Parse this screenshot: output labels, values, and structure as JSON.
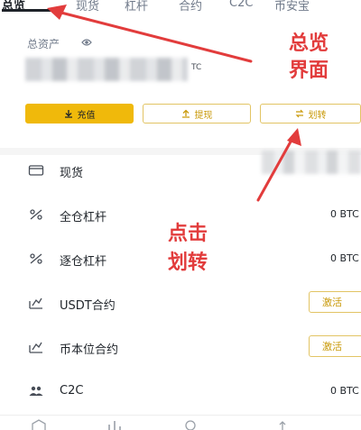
{
  "tabs": [
    {
      "label": "总览",
      "active": true
    },
    {
      "label": "现货",
      "active": false
    },
    {
      "label": "杠杆",
      "active": false
    },
    {
      "label": "合约",
      "active": false
    },
    {
      "label": "C2C",
      "active": false
    },
    {
      "label": "币安宝",
      "active": false
    }
  ],
  "assets": {
    "label": "总资产",
    "unit": "TC"
  },
  "actions": {
    "deposit": "充值",
    "withdraw": "提现",
    "transfer": "划转"
  },
  "accounts": [
    {
      "label": "现货",
      "value": "",
      "icon": "wallet-icon"
    },
    {
      "label": "全仓杠杆",
      "value": "0 BTC",
      "icon": "percent-icon"
    },
    {
      "label": "逐仓杠杆",
      "value": "0 BTC",
      "icon": "percent-icon"
    },
    {
      "label": "USDT合约",
      "value": "",
      "action": "激活",
      "icon": "futures-icon"
    },
    {
      "label": "币本位合约",
      "value": "",
      "action": "激活",
      "icon": "futures-icon"
    },
    {
      "label": "C2C",
      "value": "0 BTC",
      "icon": "users-icon"
    }
  ],
  "annotations": {
    "overview_line1": "总览",
    "overview_line2": "界面",
    "click_line1": "点击",
    "click_line2": "划转"
  },
  "colors": {
    "accent": "#f0b90b",
    "annotation": "#e23c3c",
    "text": "#1e2329",
    "muted": "#707a8a"
  }
}
